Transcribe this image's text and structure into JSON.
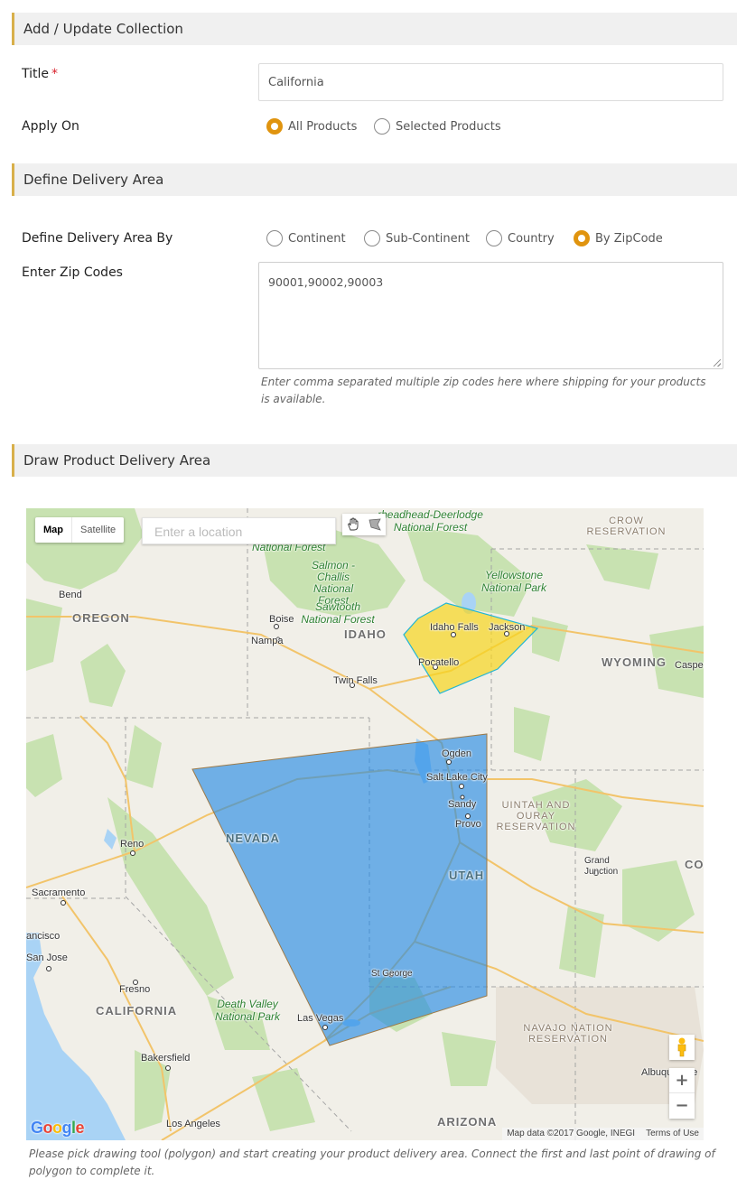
{
  "sections": {
    "collection": "Add / Update Collection",
    "delivery": "Define Delivery Area",
    "draw": "Draw Product Delivery Area"
  },
  "form": {
    "title_label": "Title",
    "required_mark": "*",
    "title_value": "California",
    "apply_on_label": "Apply On",
    "apply_on_options": [
      {
        "label": "All Products",
        "checked": true
      },
      {
        "label": "Selected Products",
        "checked": false
      }
    ],
    "area_by_label": "Define Delivery Area By",
    "area_by_options": [
      {
        "label": "Continent",
        "checked": false
      },
      {
        "label": "Sub-Continent",
        "checked": false
      },
      {
        "label": "Country",
        "checked": false
      },
      {
        "label": "By ZipCode",
        "checked": true
      }
    ],
    "zip_label": "Enter Zip Codes",
    "zip_value": "90001,90002,90003",
    "zip_help": "Enter comma separated multiple zip codes here where shipping for your products is available."
  },
  "map": {
    "type_controls": [
      "Map",
      "Satellite"
    ],
    "search_placeholder": "Enter a location",
    "draw_tools": [
      "hand-icon",
      "polygon-icon"
    ],
    "states": [
      "OREGON",
      "IDAHO",
      "WYOMING",
      "NEVADA",
      "UTAH",
      "CALIFORNIA",
      "ARIZONA",
      "CO"
    ],
    "cities": [
      "Bend",
      "Boise",
      "Nampa",
      "Twin Falls",
      "Idaho Falls",
      "Pocatello",
      "Jackson",
      "Casper",
      "Ogden",
      "Salt Lake City",
      "Sandy",
      "Provo",
      "Reno",
      "Sacramento",
      "ancisco",
      "San Jose",
      "Fresno",
      "Bakersfield",
      "Los Angeles",
      "Las Vegas",
      "St George",
      "Grand Junction",
      "Albuquerque"
    ],
    "parks": [
      "Salmon - Challis National Forest",
      "Sawtooth National Forest",
      "Yellowstone National Park",
      "Death Valley National Park",
      "rheadhead-Deerlodge National Forest",
      "National Forest"
    ],
    "reservations": [
      "CROW RESERVATION",
      "UINTAH AND OURAY RESERVATION",
      "NAVAJO NATION RESERVATION"
    ],
    "zoom_in": "+",
    "zoom_out": "−",
    "logo": "Google",
    "attribution": "Map data ©2017 Google, INEGI",
    "terms": "Terms of Use",
    "polygon_colors": {
      "blue": "#1e88e5",
      "yellow": "#f7d51e"
    },
    "help": "Please pick drawing tool (polygon) and start creating your product delivery area. Connect the first and last point of drawing of polygon to complete it."
  }
}
